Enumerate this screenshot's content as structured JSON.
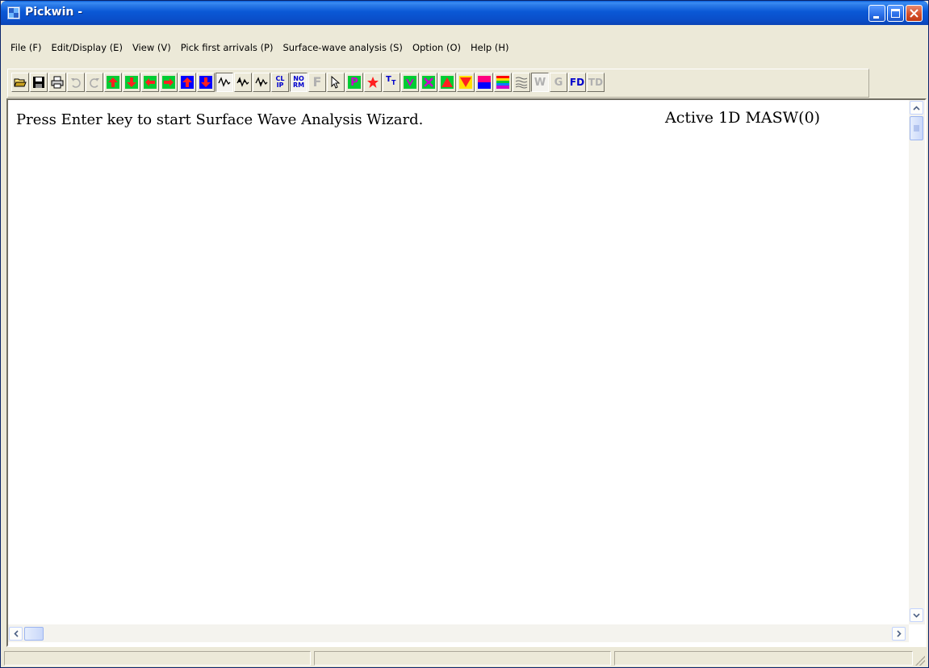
{
  "window": {
    "title": "Pickwin -"
  },
  "menu": {
    "items": [
      {
        "label": "File (F)"
      },
      {
        "label": "Edit/Display (E)"
      },
      {
        "label": "View (V)"
      },
      {
        "label": "Pick first arrivals (P)"
      },
      {
        "label": "Surface-wave analysis (S)"
      },
      {
        "label": "Option (O)"
      },
      {
        "label": "Help (H)"
      }
    ]
  },
  "toolbar": {
    "clip_label_top": "CL",
    "clip_label_bottom": "IP",
    "norm_label_top": "NO",
    "norm_label_bottom": "RM",
    "f_label": "F",
    "p_label": "P",
    "tt_label": "T",
    "tt_sub_label": "T",
    "w_label": "W",
    "g_label": "G",
    "fd_label": "FD",
    "td_label": "TD"
  },
  "main": {
    "message": "Press Enter key to start Surface Wave Analysis Wizard.",
    "mode_text": "Active 1D MASW(0)"
  },
  "colors": {
    "titlebar": "#0a58d6",
    "window_bg": "#ece9d8",
    "toolbar_green": "#00cc33",
    "toolbar_red": "#ff2020",
    "toolbar_blue": "#0000ff"
  }
}
